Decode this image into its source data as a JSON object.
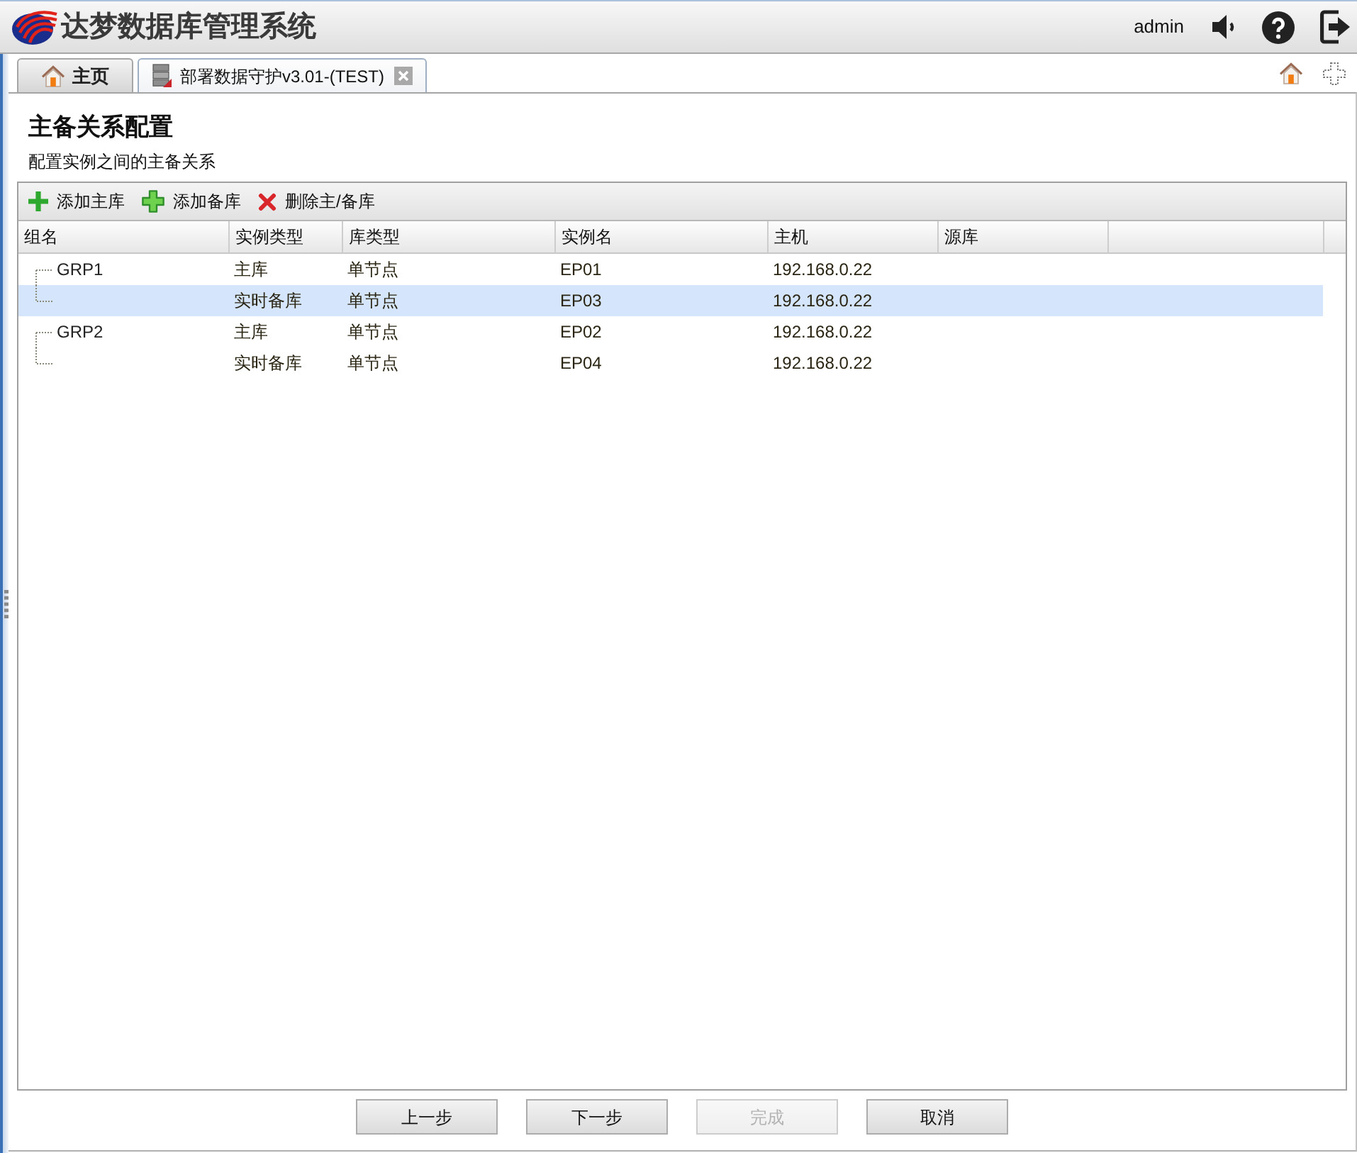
{
  "header": {
    "app_title": "达梦数据库管理系统",
    "user": "admin"
  },
  "tabs": [
    {
      "label": "主页",
      "kind": "home",
      "selected": false,
      "closable": false
    },
    {
      "label": "部署数据守护v3.01-(TEST)",
      "kind": "deploy",
      "selected": true,
      "closable": true
    }
  ],
  "page": {
    "title": "主备关系配置",
    "subtitle": "配置实例之间的主备关系"
  },
  "toolbar": [
    {
      "label": "添加主库",
      "kind": "add-primary"
    },
    {
      "label": "添加备库",
      "kind": "add-standby"
    },
    {
      "label": "删除主/备库",
      "kind": "delete"
    }
  ],
  "table": {
    "columns": [
      "组名",
      "实例类型",
      "库类型",
      "实例名",
      "主机",
      "源库"
    ],
    "groups": [
      {
        "name": "GRP1",
        "rows": [
          {
            "instance_type": "主库",
            "db_type": "单节点",
            "instance_name": "EP01",
            "host": "192.168.0.22",
            "selected": false
          },
          {
            "instance_type": "实时备库",
            "db_type": "单节点",
            "instance_name": "EP03",
            "host": "192.168.0.22",
            "selected": true
          }
        ]
      },
      {
        "name": "GRP2",
        "rows": [
          {
            "instance_type": "主库",
            "db_type": "单节点",
            "instance_name": "EP02",
            "host": "192.168.0.22",
            "selected": false
          },
          {
            "instance_type": "实时备库",
            "db_type": "单节点",
            "instance_name": "EP04",
            "host": "192.168.0.22",
            "selected": false
          }
        ]
      }
    ]
  },
  "buttons": [
    {
      "label": "上一步",
      "disabled": false
    },
    {
      "label": "下一步",
      "disabled": false
    },
    {
      "label": "完成",
      "disabled": true
    },
    {
      "label": "取消",
      "disabled": false
    }
  ]
}
